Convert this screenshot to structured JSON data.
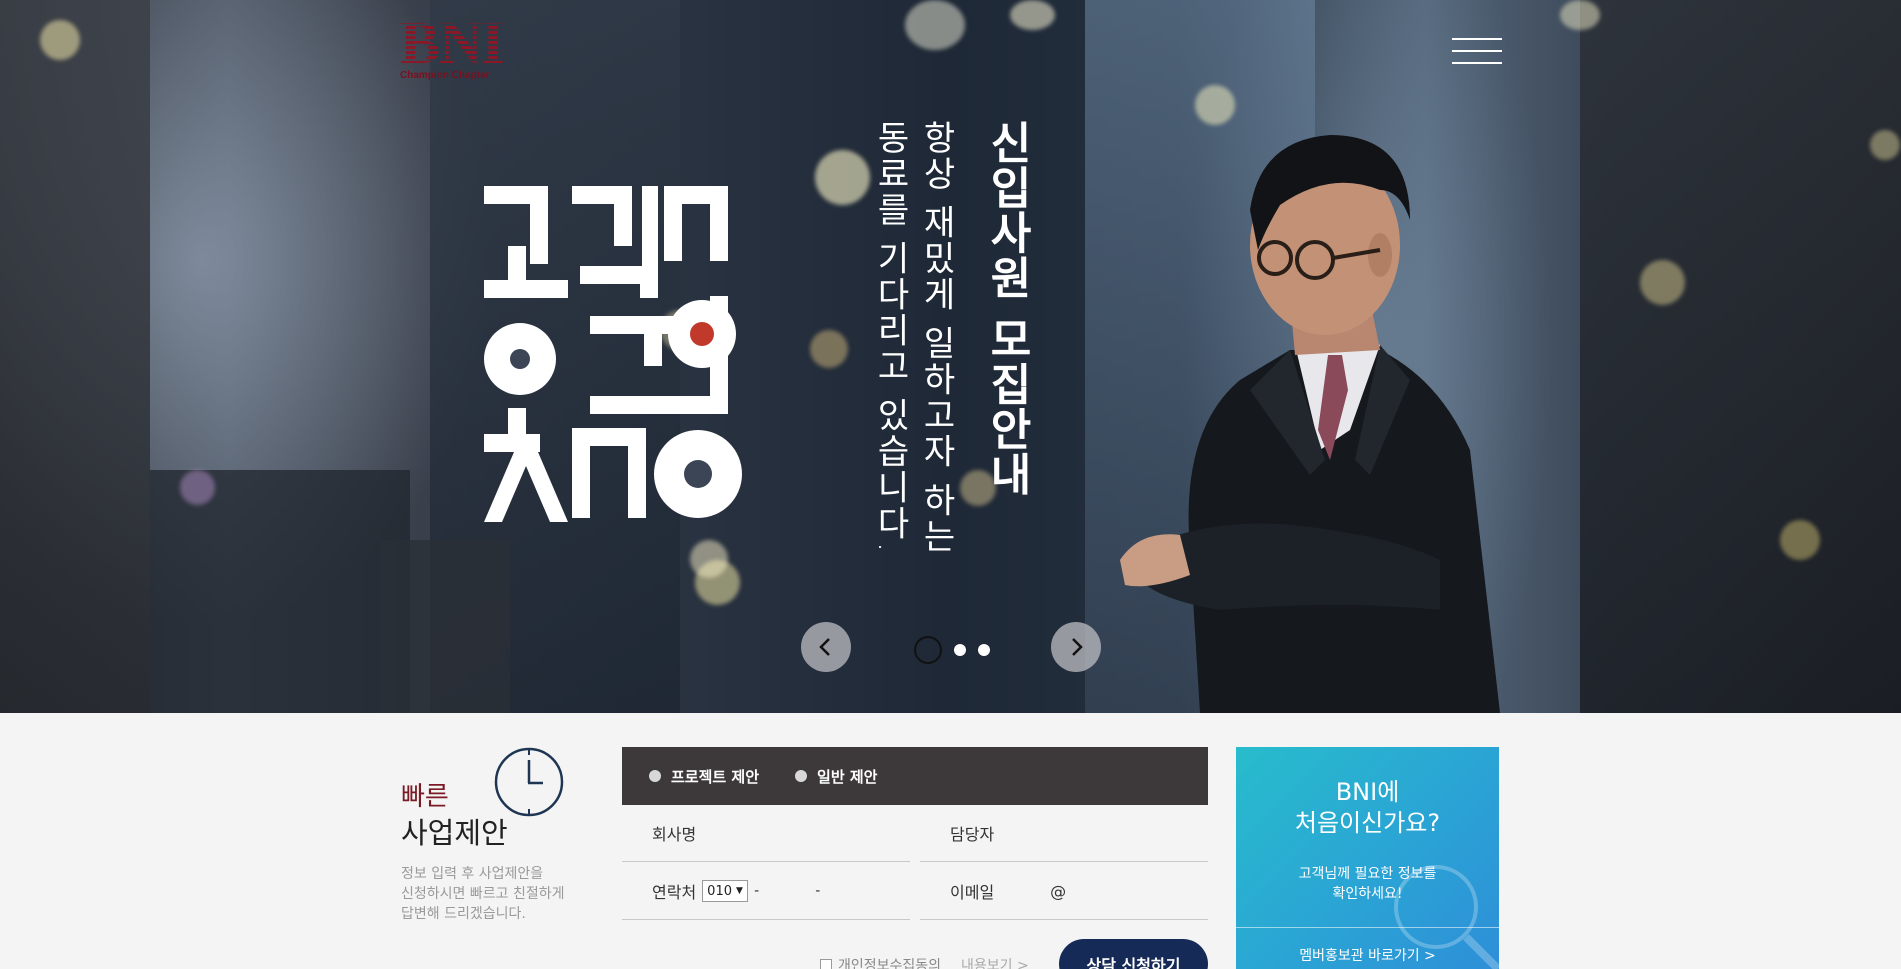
{
  "header": {
    "logo_text": "BNI",
    "logo_sub": "Champion Chapter",
    "menu_icon": "hamburger-icon"
  },
  "hero": {
    "title_art_text": "고객중심",
    "vertical_title": "신입사원 모집안내",
    "vertical_sub_line1": "항상 재밌게 일하고자 하는",
    "vertical_sub_line2": "동료를 기다리고 있습니다.",
    "prev_icon": "chevron-left-icon",
    "next_icon": "chevron-right-icon",
    "slide_count": 3,
    "active_slide": 1
  },
  "quick": {
    "label1": "빠른",
    "label2": "사업제안",
    "desc_line1": "정보 입력 후 사업제안을",
    "desc_line2": "신청하시면 빠르고 친절하게",
    "desc_line3": "답변해 드리겠습니다.",
    "icon": "clock-icon"
  },
  "form": {
    "tabs": [
      {
        "label": "프로젝트 제안"
      },
      {
        "label": "일반 제안"
      }
    ],
    "company_label": "회사명",
    "manager_label": "담당자",
    "phone_label": "연락처",
    "phone_prefix": "010",
    "phone_sep": "-",
    "email_label": "이메일",
    "email_at": "@",
    "agree_label": "개인정보수집동의",
    "agree_more": "내용보기 >",
    "submit_label": "상담 신청하기"
  },
  "promo": {
    "title_line1": "BNI에",
    "title_line2": "처음이신가요?",
    "desc_line1": "고객님께 필요한 정보를",
    "desc_line2": "확인하세요!",
    "link_label": "멤버홍보관 바로가기 >"
  },
  "colors": {
    "brand_red": "#8c1727",
    "form_header": "#3d393a",
    "submit_navy": "#152a56",
    "promo_teal": "#28bccc"
  }
}
